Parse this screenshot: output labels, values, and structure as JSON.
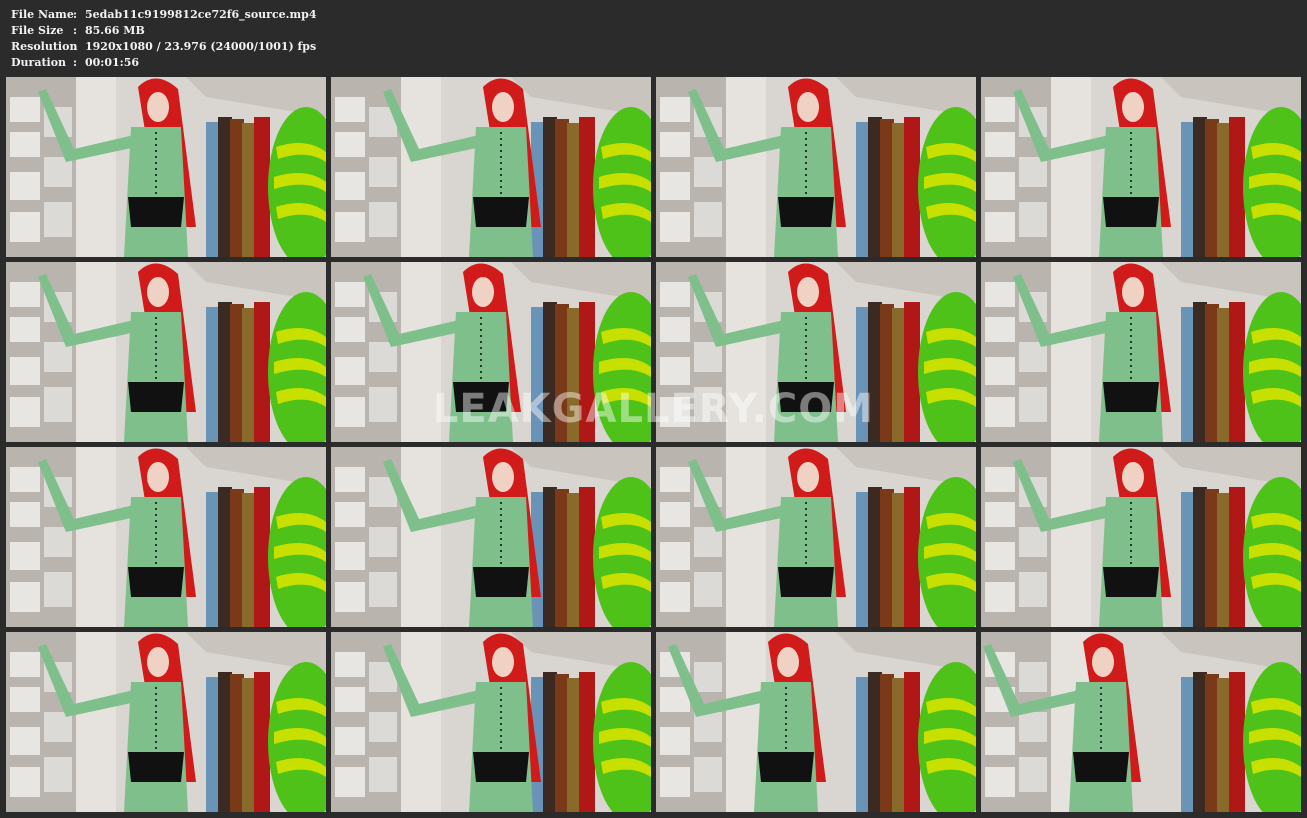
{
  "info": {
    "file_name_label": "File Name",
    "file_name": "5edab11c9199812ce72f6_source.mp4",
    "file_size_label": "File Size",
    "file_size": "85.66 MB",
    "resolution_label": "Resolution",
    "resolution": "1920x1080 / 23.976 (24000/1001) fps",
    "duration_label": "Duration",
    "duration": "00:01:56",
    "separator": ":"
  },
  "watermark": "LEAKGALLERY.COM",
  "thumbnail_count": 16,
  "colors": {
    "background": "#2b2b2b",
    "text": "#f2f2f2",
    "hair": "#d11a1a",
    "outfit": "#7fbf8c",
    "corset": "#111111",
    "inflatable_green": "#4fc21a",
    "inflatable_yellow": "#c8e000"
  }
}
